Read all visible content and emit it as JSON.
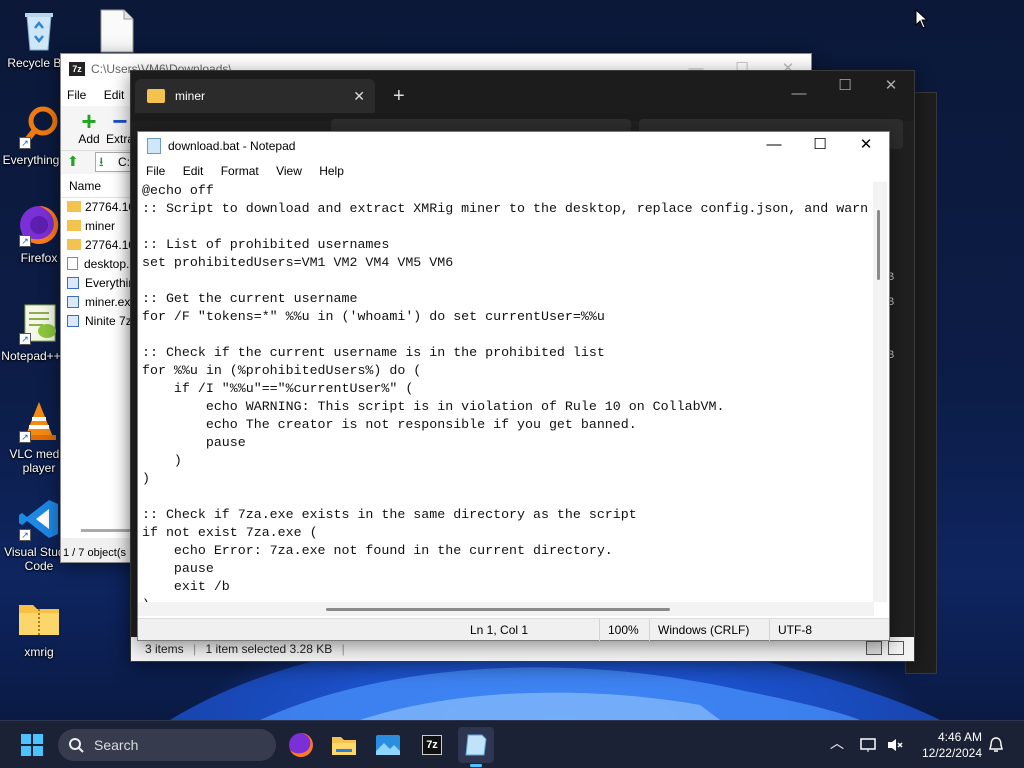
{
  "desktop": {
    "icons": [
      {
        "label": "Recycle Bin"
      },
      {
        "label": "Everything"
      },
      {
        "label": "Firefox"
      },
      {
        "label": "Notepad++"
      },
      {
        "label": "VLC media player"
      },
      {
        "label": "Visual Studio Code"
      },
      {
        "label": "xmrig"
      }
    ]
  },
  "sevenzip": {
    "title": "C:\\Users\\VM6\\Downloads\\",
    "menu": [
      "File",
      "Edit"
    ],
    "toolbar": {
      "add": "Add",
      "extract": "Extra"
    },
    "address": "C:",
    "column_name": "Name",
    "files": [
      "27764.10",
      "miner",
      "27764.10",
      "desktop.",
      "Everythin",
      "miner.ex",
      "Ninite 7z"
    ],
    "status": "1 / 7 object(s"
  },
  "explorer": {
    "tab_title": "miner",
    "status": {
      "items": "3 items",
      "selected": "1 item selected  3.28 KB"
    },
    "sizes": [
      "B",
      "B",
      "B"
    ]
  },
  "notepad": {
    "title": "download.bat - Notepad",
    "menu": [
      "File",
      "Edit",
      "Format",
      "View",
      "Help"
    ],
    "lines": [
      "@echo off",
      ":: Script to download and extract XMRig miner to the desktop, replace config.json, and warn",
      "",
      ":: List of prohibited usernames",
      "set prohibitedUsers=VM1 VM2 VM4 VM5 VM6",
      "",
      ":: Get the current username",
      "for /F \"tokens=*\" %%u in ('whoami') do set currentUser=%%u",
      "",
      ":: Check if the current username is in the prohibited list",
      "for %%u in (%prohibitedUsers%) do (",
      "    if /I \"%%u\"==\"%currentUser%\" (",
      "        echo WARNING: This script is in violation of Rule 10 on CollabVM.",
      "        echo The creator is not responsible if you get banned.",
      "        pause",
      "    )",
      ")",
      "",
      ":: Check if 7za.exe exists in the same directory as the script",
      "if not exist 7za.exe (",
      "    echo Error: 7za.exe not found in the current directory.",
      "    pause",
      "    exit /b",
      ")"
    ],
    "status": {
      "position": "Ln 1, Col 1",
      "zoom": "100%",
      "eol": "Windows (CRLF)",
      "encoding": "UTF-8"
    }
  },
  "taskbar": {
    "search_placeholder": "Search",
    "time": "4:46 AM",
    "date": "12/22/2024"
  },
  "colors": {
    "accent": "#0067c0",
    "taskbar_bg": "#1c2235",
    "explorer_bg": "#202020"
  }
}
